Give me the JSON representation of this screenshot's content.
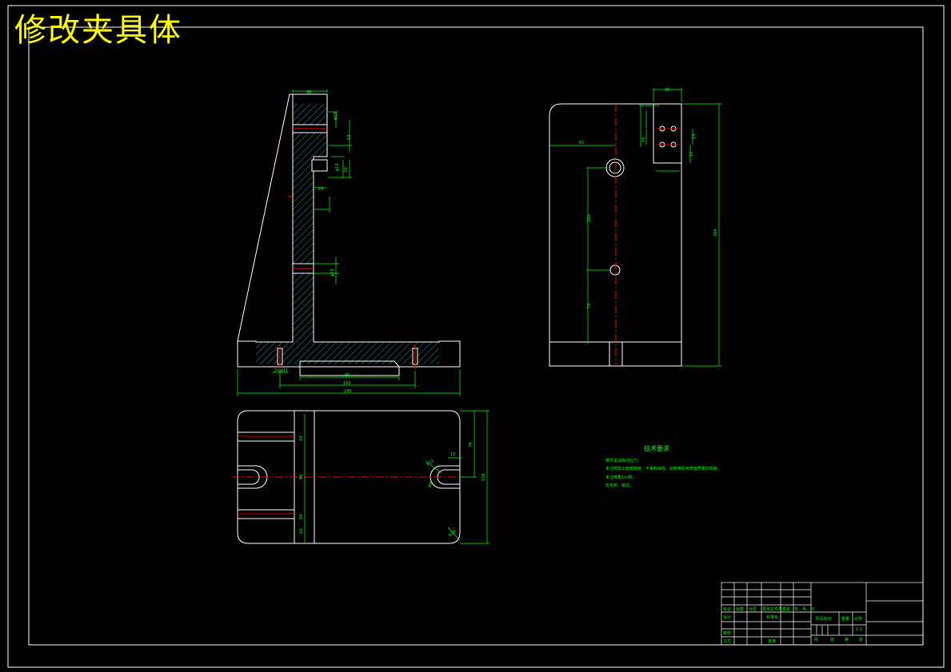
{
  "drawing": {
    "title": "修改夹具体",
    "technical_requirements": {
      "heading": "技术要求",
      "items": [
        "铸件需消除内应力。",
        "未注明加工面粗糙度，不得有缺陷、划痕等影响表面质量的瑕疵。",
        "未注倒角1×45。",
        "去毛刺、锐边。"
      ]
    },
    "title_block": {
      "headers": [
        "标记",
        "处数",
        "分区",
        "更改文件号",
        "签名",
        "年、月、日"
      ],
      "row_design": "设计",
      "row_standard": "标准化",
      "row_check": "审核",
      "row_process": "工艺",
      "row_approve": "批准",
      "stage_label": "阶段标记",
      "weight_label": "重量",
      "scale_label": "比例",
      "scale_value": "1:1",
      "sheet_total": "共",
      "sheet_unit": "张",
      "sheet_no": "第",
      "sheet_unit2": "张"
    }
  },
  "colors": {
    "background": "#000000",
    "outline": "#ffffff",
    "dimension": "#00ff00",
    "centerline": "#ff0000",
    "title": "#ffff00",
    "hatch": "#00a0a0"
  }
}
